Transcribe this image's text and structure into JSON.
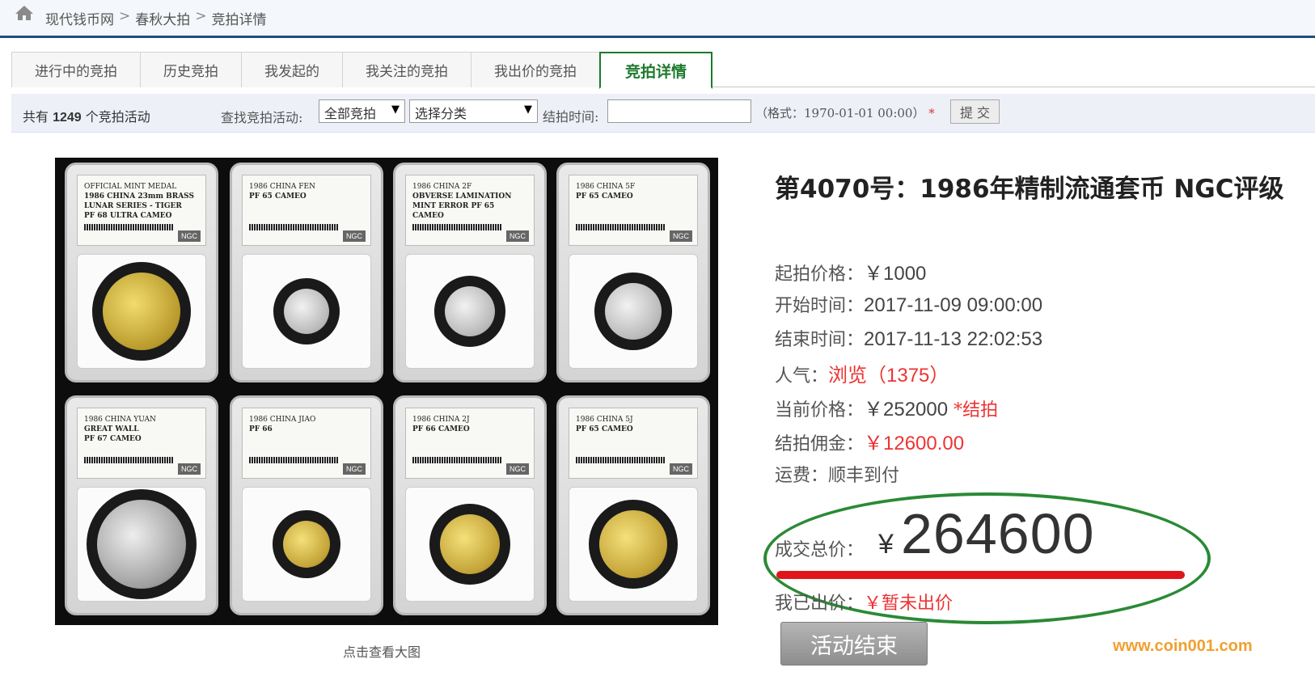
{
  "breadcrumb": {
    "items": [
      "现代钱币网",
      "春秋大拍",
      "竞拍详情"
    ],
    "separator": ">"
  },
  "tabs": [
    {
      "label": "进行中的竞拍",
      "active": false
    },
    {
      "label": "历史竞拍",
      "active": false
    },
    {
      "label": "我发起的",
      "active": false
    },
    {
      "label": "我关注的竞拍",
      "active": false
    },
    {
      "label": "我出价的竞拍",
      "active": false
    },
    {
      "label": "竞拍详情",
      "active": true
    }
  ],
  "filter": {
    "total_prefix": "共有",
    "total_count": "1249",
    "total_suffix": "个竞拍活动",
    "find_label": "查找竞拍活动:",
    "select_all": "全部竞拍",
    "select_category": "选择分类",
    "end_time_label": "结拍时间:",
    "end_time_value": "",
    "format_hint": "（格式：1970-01-01 00:00）",
    "required_mark": "*",
    "submit_label": "提 交"
  },
  "product": {
    "slabs": [
      {
        "line1": "OFFICIAL MINT MEDAL",
        "line2": "1986 CHINA 23mm BRASS",
        "line3": "LUNAR SERIES - TIGER",
        "line4": "PF 68 ULTRA CAMEO"
      },
      {
        "line1": "1986 CHINA FEN",
        "line2": "PF 65 CAMEO",
        "line3": "",
        "line4": ""
      },
      {
        "line1": "1986 CHINA 2F",
        "line2": "OBVERSE LAMINATION",
        "line3": "MINT ERROR PF 65 CAMEO",
        "line4": ""
      },
      {
        "line1": "1986 CHINA 5F",
        "line2": "PF 65 CAMEO",
        "line3": "",
        "line4": ""
      },
      {
        "line1": "1986 CHINA YUAN",
        "line2": "GREAT WALL",
        "line3": "PF 67 CAMEO",
        "line4": ""
      },
      {
        "line1": "1986 CHINA JIAO",
        "line2": "PF 66",
        "line3": "",
        "line4": ""
      },
      {
        "line1": "1986 CHINA 2J",
        "line2": "PF 66 CAMEO",
        "line3": "",
        "line4": ""
      },
      {
        "line1": "1986 CHINA 5J",
        "line2": "PF 65 CAMEO",
        "line3": "",
        "line4": ""
      }
    ],
    "ngc_mark": "NGC",
    "caption": "点击查看大图"
  },
  "auction": {
    "title": "第4070号：1986年精制流通套币 NGC评级",
    "start_price_label": "起拍价格：",
    "start_price": "￥1000",
    "start_time_label": "开始时间：",
    "start_time": "2017-11-09 09:00:00",
    "end_time_label": "结束时间：",
    "end_time": "2017-11-13 22:02:53",
    "popularity_label": "人气：",
    "popularity": "浏览（1375）",
    "current_price_label": "当前价格：",
    "current_price": "￥252000",
    "current_status": "*结拍",
    "commission_label": "结拍佣金：",
    "commission": "￥12600.00",
    "shipping_label": "运费：",
    "shipping": "顺丰到付",
    "total_label": "成交总价：",
    "total_currency": "¥",
    "total_value": "264600",
    "my_bid_label": "我已出价：",
    "my_bid": "￥暂未出价",
    "end_button": "活动结束"
  },
  "watermark": "www.coin001.com",
  "colors": {
    "accent_red": "#e33333",
    "active_tab_green": "#1a7a2a",
    "header_rule": "#1d4f7a",
    "highlight_red": "#e0151b",
    "watermark": "#f0a030"
  }
}
